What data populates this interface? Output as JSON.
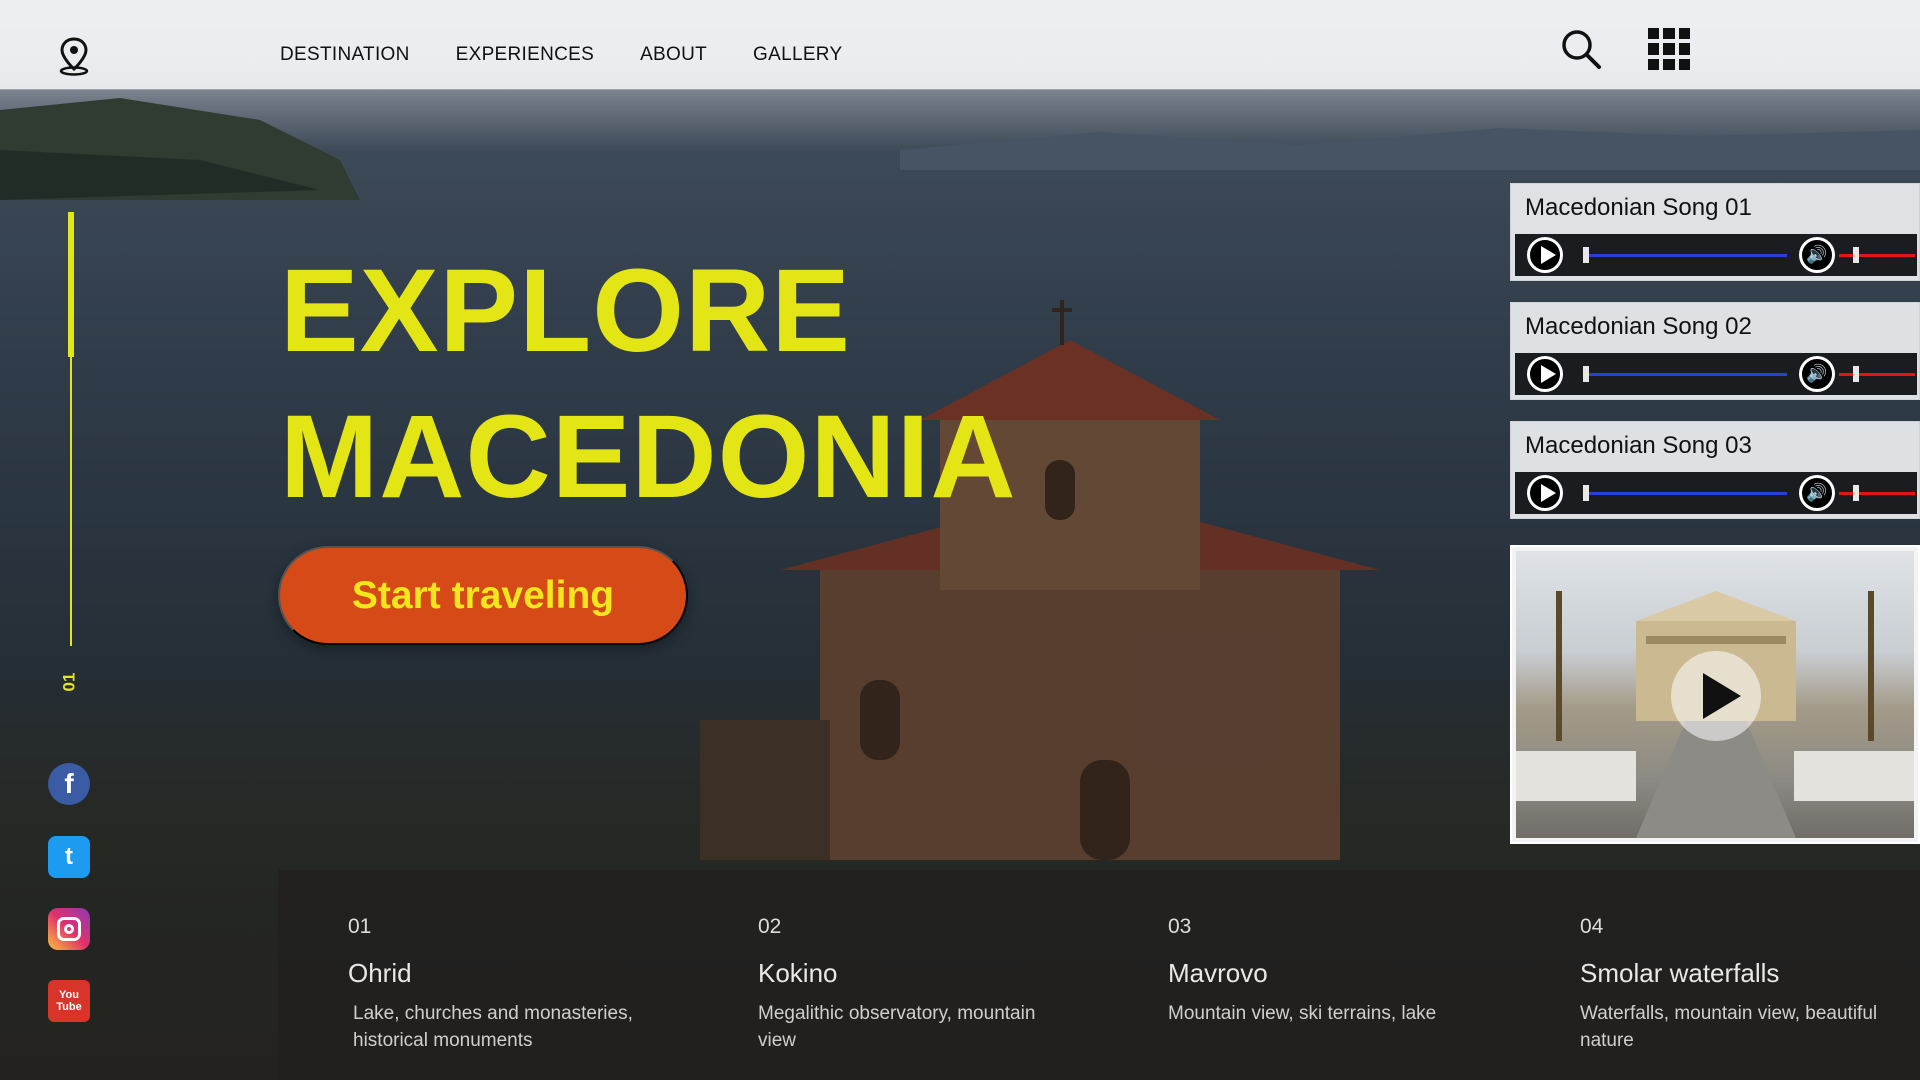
{
  "nav": {
    "items": [
      "DESTINATION",
      "EXPERIENCES",
      "ABOUT",
      "GALLERY"
    ],
    "icons": {
      "location": "map-pin-icon",
      "search": "search-icon",
      "menu": "apps-grid-icon"
    }
  },
  "rail": {
    "slide_number": "01"
  },
  "hero": {
    "line1": "EXPLORE",
    "line2": "MACEDONIA",
    "cta": "Start traveling"
  },
  "social": [
    {
      "name": "facebook",
      "glyph": "f"
    },
    {
      "name": "twitter",
      "glyph": "t"
    },
    {
      "name": "instagram",
      "glyph": ""
    },
    {
      "name": "youtube",
      "glyph": "You Tube"
    }
  ],
  "songs": [
    {
      "title": "Macedonian Song 01"
    },
    {
      "title": "Macedonian Song 02"
    },
    {
      "title": "Macedonian Song 03"
    }
  ],
  "colors": {
    "accent": "#e3e614",
    "cta": "#d54a17",
    "progress": "#2443d6",
    "volume": "#e11616"
  },
  "destinations": [
    {
      "num": "01",
      "name": "Ohrid",
      "desc": "Lake, churches and monasteries, historical monuments"
    },
    {
      "num": "02",
      "name": "Kokino",
      "desc": "Megalithic observatory, mountain view"
    },
    {
      "num": "03",
      "name": "Mavrovo",
      "desc": "Mountain view, ski terrains, lake"
    },
    {
      "num": "04",
      "name": "Smolar waterfalls",
      "desc": "Waterfalls, mountain view, beautiful nature"
    }
  ]
}
